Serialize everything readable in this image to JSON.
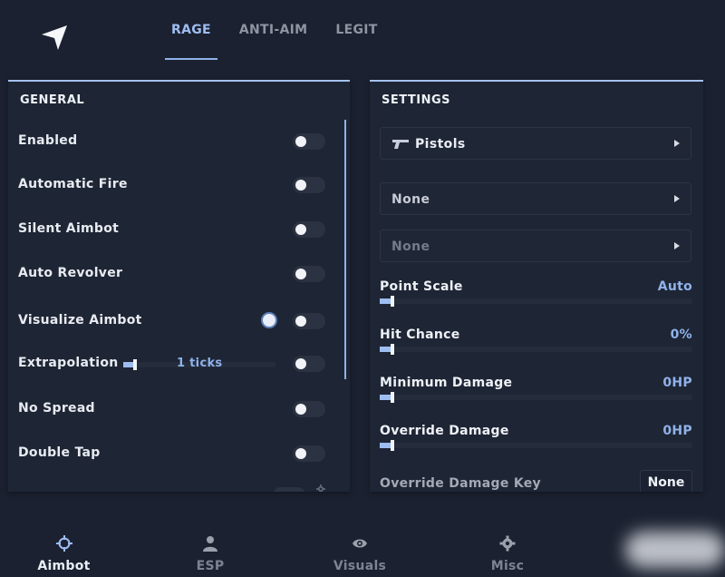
{
  "top_tabs": [
    {
      "label": "RAGE",
      "active": true
    },
    {
      "label": "ANTI-AIM",
      "active": false
    },
    {
      "label": "LEGIT",
      "active": false
    }
  ],
  "general": {
    "title": "GENERAL",
    "rows": [
      {
        "label": "Enabled",
        "enabled": false
      },
      {
        "label": "Automatic Fire",
        "enabled": false
      },
      {
        "label": "Silent Aimbot",
        "enabled": false
      },
      {
        "label": "Auto Revolver",
        "enabled": false
      },
      {
        "label": "Visualize Aimbot",
        "enabled": false
      },
      {
        "label": "Extrapolation",
        "enabled": false
      },
      {
        "label": "No Spread",
        "enabled": false
      },
      {
        "label": "Double Tap",
        "enabled": false
      }
    ],
    "extrapolation_value": "1 ticks",
    "extrapolation_level": 0.08,
    "visualize_color": "#e9eef8"
  },
  "settings": {
    "title": "SETTINGS",
    "weapon_dropdown": "Pistols",
    "dropdown_2": "None",
    "dropdown_3": "None",
    "sliders": [
      {
        "label": "Point Scale",
        "value": "Auto",
        "level": 0.04
      },
      {
        "label": "Hit Chance",
        "value": "0%",
        "level": 0.04
      },
      {
        "label": "Minimum Damage",
        "value": "0HP",
        "level": 0.04
      },
      {
        "label": "Override Damage",
        "value": "0HP",
        "level": 0.04
      }
    ],
    "override_key_label": "Override Damage Key",
    "override_key_value": "None"
  },
  "bottom_nav": [
    {
      "label": "Aimbot",
      "icon": "crosshair-icon",
      "active": true
    },
    {
      "label": "ESP",
      "icon": "user-icon",
      "active": false
    },
    {
      "label": "Visuals",
      "icon": "eye-icon",
      "active": false
    },
    {
      "label": "Misc",
      "icon": "gear-icon",
      "active": false
    }
  ],
  "colors": {
    "accent": "#8fb2ea",
    "background": "#1b2130",
    "panel": "#1e2534"
  }
}
